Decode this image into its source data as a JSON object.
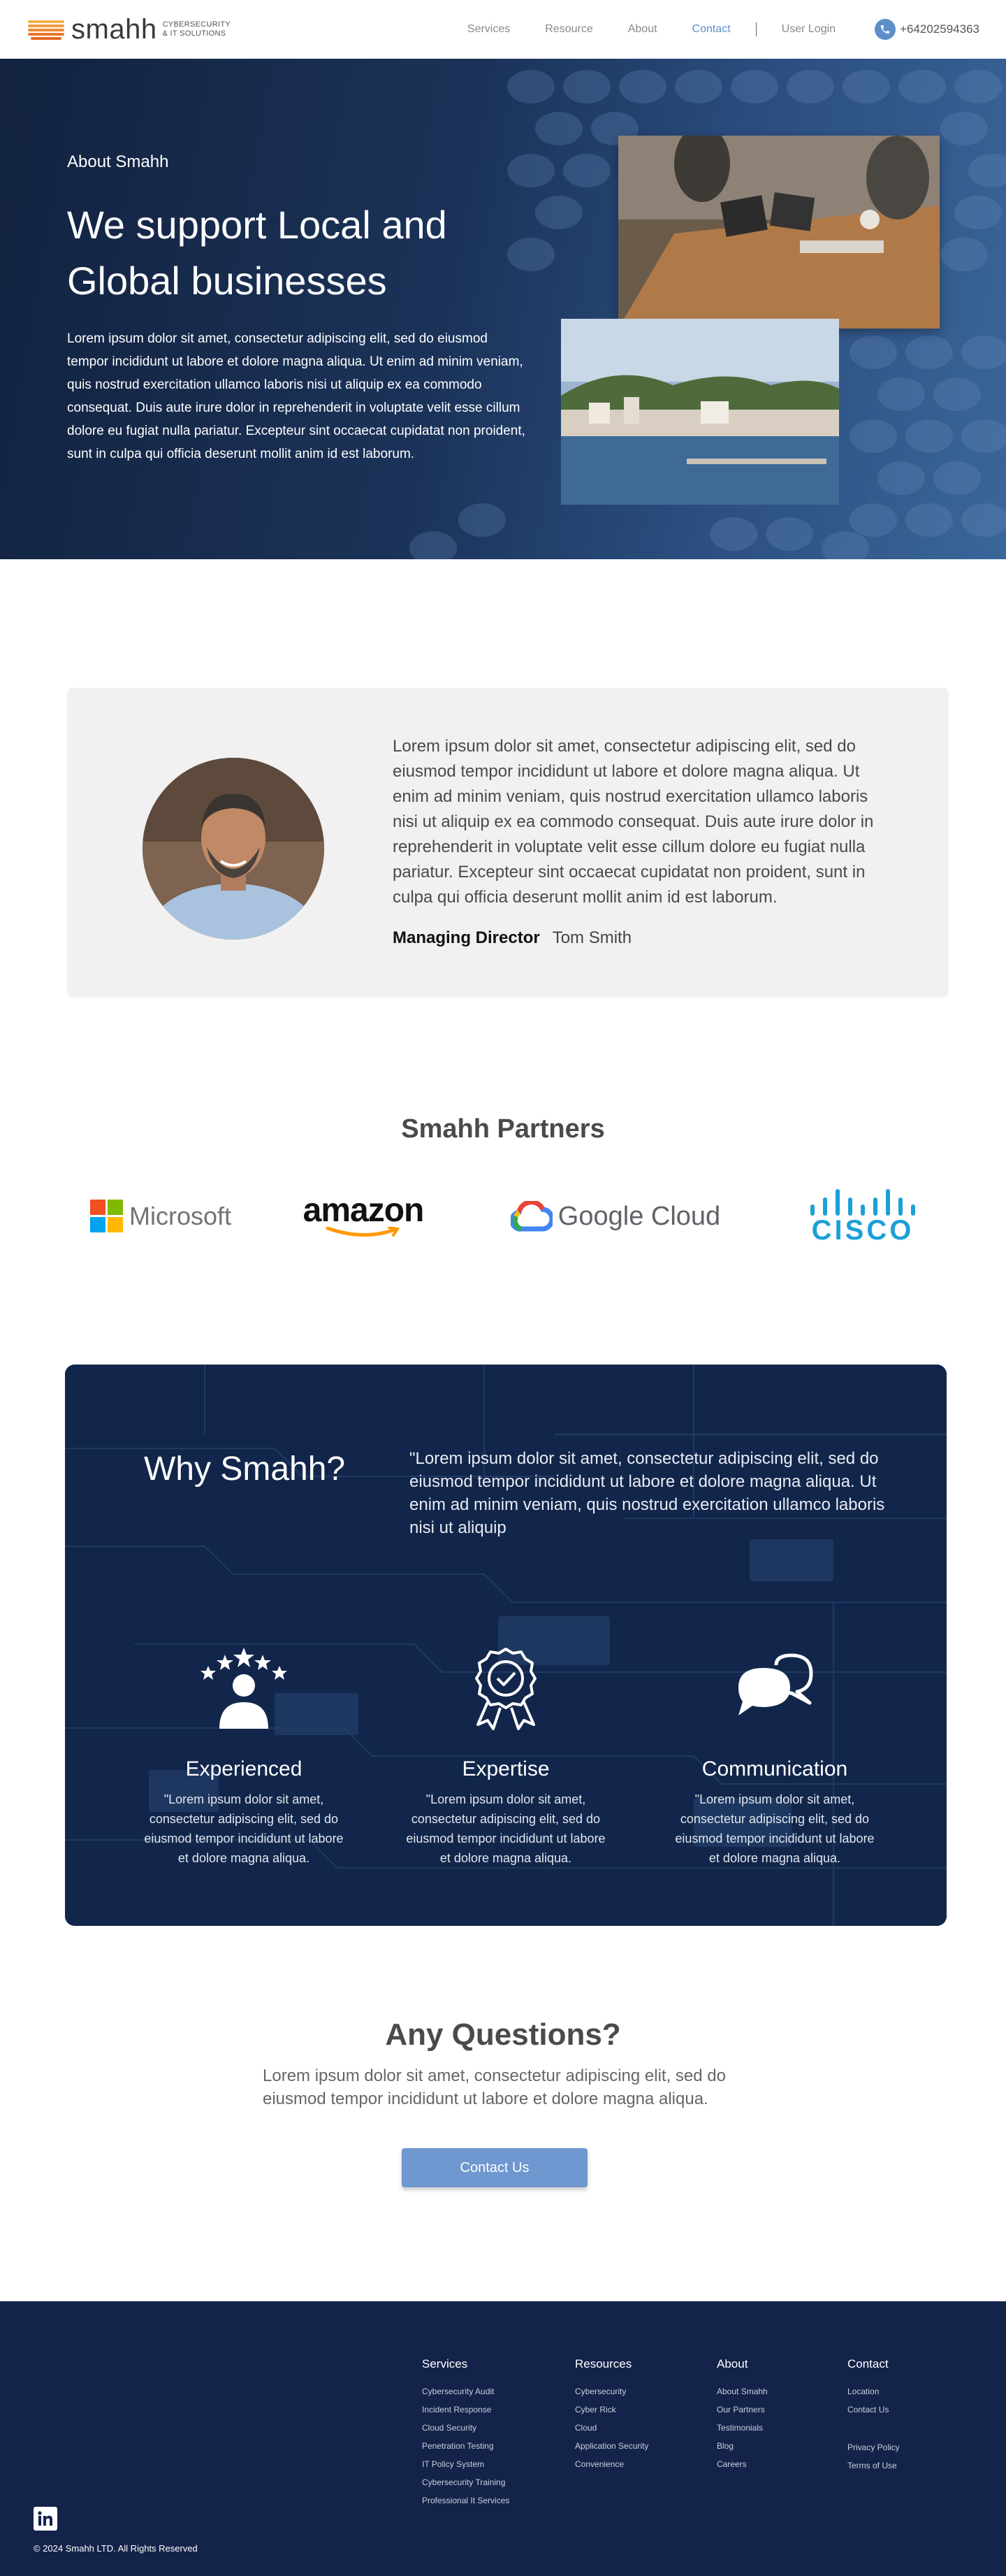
{
  "header": {
    "logo_word": "smahh",
    "logo_tagline_1": "CYBERSECURITY",
    "logo_tagline_2": "& IT SOLUTIONS",
    "nav": [
      "Services",
      "Resource",
      "About",
      "Contact"
    ],
    "active_nav": "Contact",
    "login": "User Login",
    "phone": "+64202594363",
    "accent": "#5f8fc9"
  },
  "hero": {
    "eyebrow": "About Smahh",
    "title_line1": "We support Local and",
    "title_line2": "Global businesses",
    "text": "Lorem ipsum dolor sit amet, consectetur adipiscing elit, sed do eiusmod tempor incididunt ut labore et dolore magna aliqua. Ut enim ad minim veniam, quis nostrud exercitation ullamco laboris nisi ut aliquip ex ea commodo consequat. Duis aute irure dolor in reprehenderit in voluptate velit esse cillum dolore eu fugiat nulla pariatur. Excepteur sint occaecat cupidatat non proident, sunt in culpa qui officia deserunt mollit anim id est laborum."
  },
  "director": {
    "quote": "Lorem ipsum dolor sit amet, consectetur adipiscing elit, sed do eiusmod tempor incididunt ut labore et dolore magna aliqua. Ut enim ad minim veniam, quis nostrud exercitation ullamco laboris nisi ut aliquip ex ea commodo consequat. Duis aute irure dolor in reprehenderit in voluptate velit esse cillum dolore eu fugiat nulla pariatur. Excepteur sint occaecat cupidatat non proident, sunt in culpa qui officia deserunt mollit anim id est laborum.",
    "role": "Managing Director",
    "name": "Tom Smith"
  },
  "partners": {
    "title": "Smahh Partners",
    "logos": [
      "Microsoft",
      "amazon",
      "Google Cloud",
      "CISCO"
    ]
  },
  "why": {
    "title": "Why Smahh?",
    "quote": "\"Lorem ipsum dolor sit amet, consectetur adipiscing elit, sed do eiusmod tempor incididunt ut labore et dolore magna aliqua. Ut enim ad minim veniam, quis nostrud exercitation ullamco laboris nisi ut aliquip",
    "features": [
      {
        "icon": "user-stars-icon",
        "title": "Experienced",
        "text": "\"Lorem ipsum dolor sit amet, consectetur adipiscing elit, sed do eiusmod tempor incididunt ut labore et dolore magna aliqua."
      },
      {
        "icon": "award-badge-icon",
        "title": "Expertise",
        "text": "\"Lorem ipsum dolor sit amet, consectetur adipiscing elit, sed do eiusmod tempor incididunt ut labore et dolore magna aliqua."
      },
      {
        "icon": "chat-bubbles-icon",
        "title": "Communication",
        "text": "\"Lorem ipsum dolor sit amet, consectetur adipiscing elit, sed do eiusmod tempor incididunt ut labore et dolore magna aliqua."
      }
    ]
  },
  "questions": {
    "title": "Any Questions?",
    "text": "Lorem ipsum dolor sit amet, consectetur adipiscing elit, sed do eiusmod tempor incididunt ut labore et dolore magna aliqua.",
    "button": "Contact Us"
  },
  "footer": {
    "columns": [
      {
        "title": "Services",
        "items": [
          "Cybersecurity Audit",
          "Incident Response",
          "Cloud Security",
          "Penetration Testing",
          "IT Policy System",
          "Cybersecurity Training",
          "Professional It Services"
        ]
      },
      {
        "title": "Resources",
        "items": [
          "Cybersecurity",
          "Cyber Rick",
          "Cloud",
          "Application Security",
          "Convenience"
        ]
      },
      {
        "title": "About",
        "items": [
          "About Smahh",
          "Our Partners",
          "Testimonials",
          "Blog",
          "Careers"
        ]
      },
      {
        "title": "Contact",
        "items": [
          "Location",
          "Contact Us",
          "Privacy Policy",
          "Terms of Use"
        ]
      }
    ],
    "copyright": "© 2024 Smahh LTD.  All Rights Reserved",
    "background": "#14234a"
  }
}
